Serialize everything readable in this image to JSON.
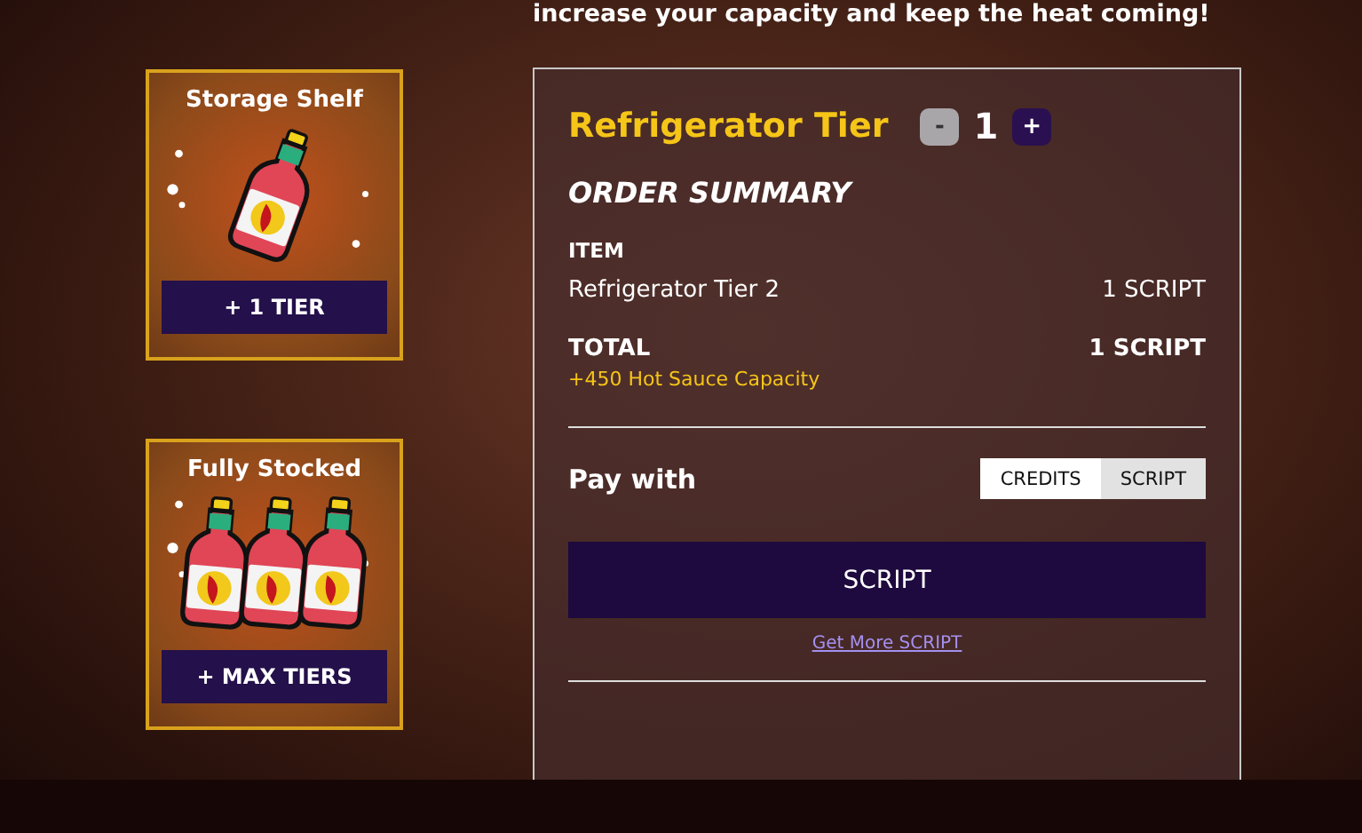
{
  "intro": "increase your capacity and keep the heat coming!",
  "offers": [
    {
      "title": "Storage Shelf",
      "kind": "single",
      "button": "+ 1 TIER"
    },
    {
      "title": "Fully Stocked",
      "kind": "set",
      "button": "+ MAX TIERS"
    }
  ],
  "order": {
    "title": "Refrigerator Tier",
    "decrement": "-",
    "quantity": "1",
    "increment": "+",
    "decrement_disabled": true,
    "summary_heading": "ORDER SUMMARY",
    "item_label": "ITEM",
    "item_name": "Refrigerator Tier 2",
    "item_price": "1 SCRIPT",
    "total_label": "TOTAL",
    "total_price": "1 SCRIPT",
    "benefit": "+450 Hot Sauce Capacity",
    "pay_label": "Pay with",
    "pay_options": [
      {
        "label": "CREDITS",
        "selected": false
      },
      {
        "label": "SCRIPT",
        "selected": true
      }
    ],
    "buy_button": "SCRIPT",
    "get_more_link": "Get More SCRIPT"
  }
}
